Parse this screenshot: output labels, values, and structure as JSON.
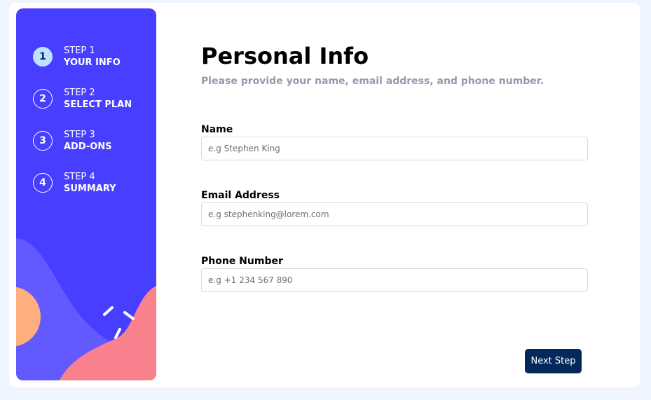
{
  "sidebar": {
    "steps": [
      {
        "number": "1",
        "label": "STEP 1",
        "title": "YOUR INFO",
        "active": true
      },
      {
        "number": "2",
        "label": "STEP 2",
        "title": "SELECT PLAN",
        "active": false
      },
      {
        "number": "3",
        "label": "STEP 3",
        "title": "ADD-ONS",
        "active": false
      },
      {
        "number": "4",
        "label": "STEP 4",
        "title": "SUMMARY",
        "active": false
      }
    ]
  },
  "main": {
    "title": "Personal Info",
    "subtitle": "Please provide your name, email address, and phone number.",
    "fields": [
      {
        "label": "Name",
        "value": "",
        "placeholder": "e.g Stephen King"
      },
      {
        "label": "Email Address",
        "value": "",
        "placeholder": "e.g stephenking@lorem.com"
      },
      {
        "label": "Phone Number",
        "value": "",
        "placeholder": "e.g +1 234 567 890"
      }
    ],
    "next_button": "Next Step"
  },
  "colors": {
    "sidebar_bg": "#483eff",
    "active_step": "#bee2fd",
    "primary_dark": "#02295a",
    "page_bg": "#eff5ff",
    "subtitle": "#9699ab",
    "border": "#d6d9e6"
  }
}
